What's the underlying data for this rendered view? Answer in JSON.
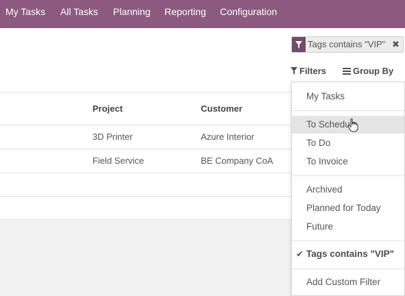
{
  "nav": {
    "items": [
      {
        "label": "My Tasks"
      },
      {
        "label": "All Tasks"
      },
      {
        "label": "Planning"
      },
      {
        "label": "Reporting"
      },
      {
        "label": "Configuration"
      }
    ],
    "bg_color": "#8b5a7e"
  },
  "search": {
    "facet_label": "Tags contains \"VIP\"",
    "facet_close": "✖"
  },
  "toolbar": {
    "filters_label": "Filters",
    "groupby_label": "Group By"
  },
  "table": {
    "columns": [
      "Project",
      "Customer"
    ],
    "rows": [
      {
        "project": "3D Printer",
        "customer": "Azure Interior"
      },
      {
        "project": "Field Service",
        "customer": "BE Company CoA"
      }
    ]
  },
  "filters_menu": {
    "items": [
      {
        "label": "My Tasks"
      },
      {
        "label": "To Schedule"
      },
      {
        "label": "To Do"
      },
      {
        "label": "To Invoice"
      },
      {
        "label": "Archived"
      },
      {
        "label": "Planned for Today"
      },
      {
        "label": "Future"
      },
      {
        "label": "Tags contains \"VIP\"",
        "checked": true
      },
      {
        "label": "Add Custom Filter"
      }
    ],
    "check_glyph": "✔"
  }
}
